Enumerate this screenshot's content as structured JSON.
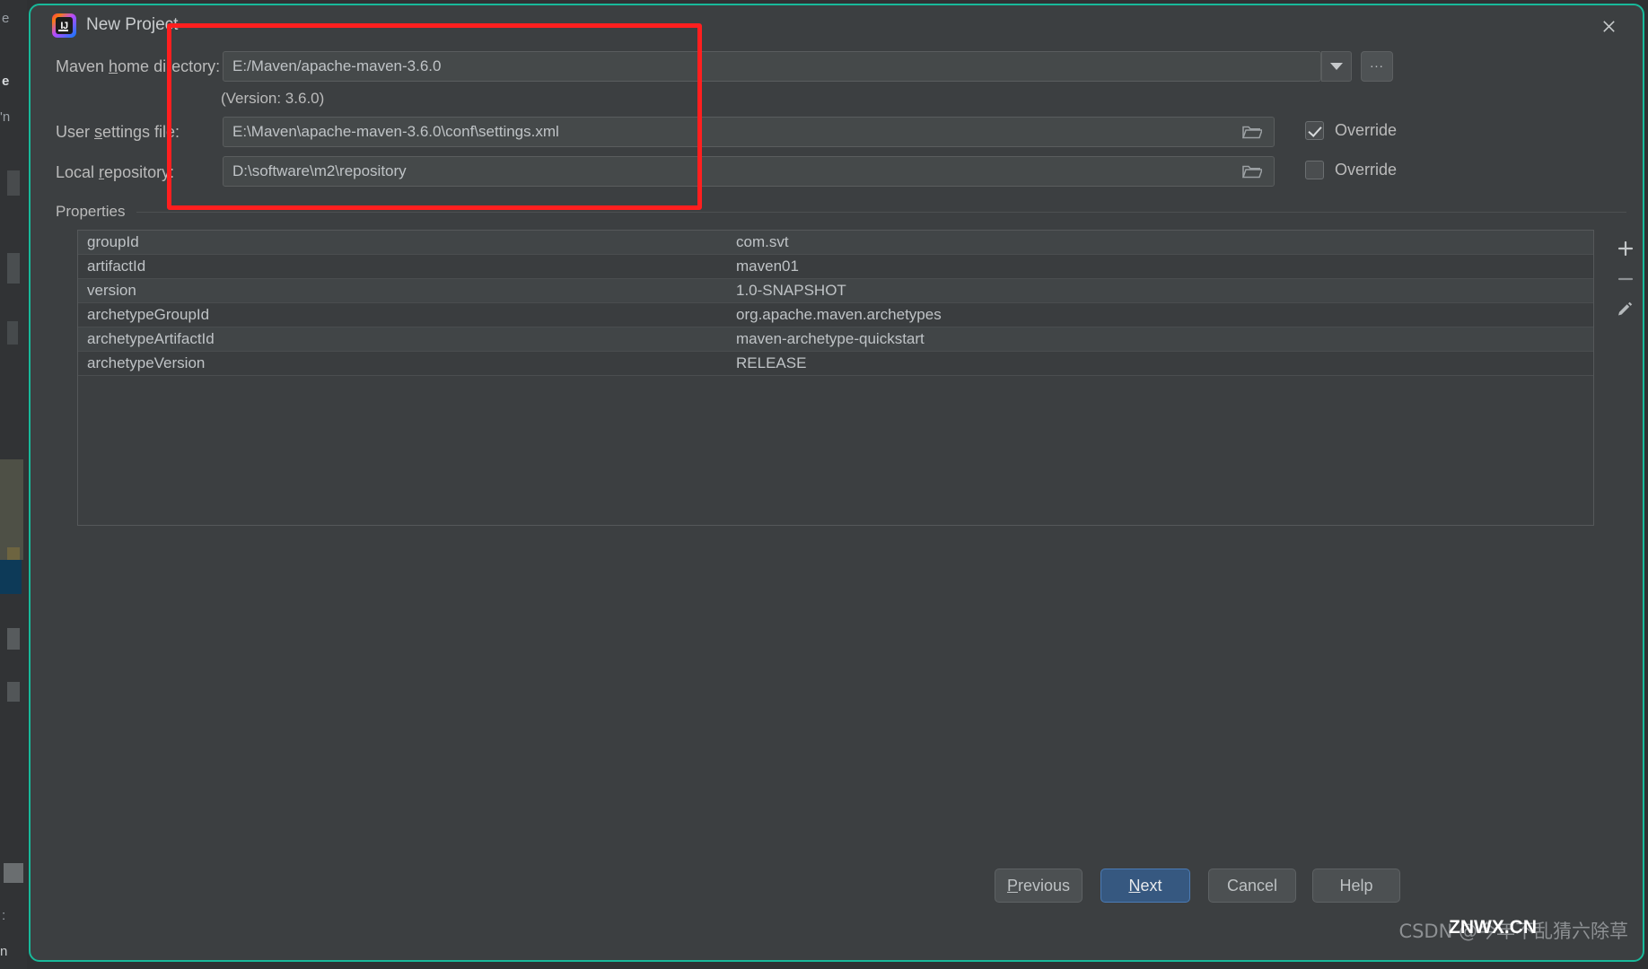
{
  "window": {
    "title": "New Project",
    "logo_icon": "intellij-idea-logo",
    "close_icon": "close-icon"
  },
  "form": {
    "maven_home": {
      "label_pre": "Maven ",
      "label_mn": "h",
      "label_post": "ome directory:",
      "value": "E:/Maven/apache-maven-3.6.0",
      "dropdown_icon": "chevron-down-icon",
      "browse_label": "..."
    },
    "version_note": "(Version: 3.6.0)",
    "user_settings": {
      "label_pre": "User ",
      "label_mn": "s",
      "label_post": "ettings file:",
      "value": "E:\\Maven\\apache-maven-3.6.0\\conf\\settings.xml",
      "folder_icon": "folder-icon",
      "override_label": "Override",
      "override_checked": true
    },
    "local_repository": {
      "label_pre": "Local ",
      "label_mn": "r",
      "label_post": "epository:",
      "value": "D:\\software\\m2\\repository",
      "folder_icon": "folder-icon",
      "override_label": "Override",
      "override_checked": false
    }
  },
  "properties": {
    "caption": "Properties",
    "rows": [
      {
        "key": "groupId",
        "value": "com.svt"
      },
      {
        "key": "artifactId",
        "value": "maven01"
      },
      {
        "key": "version",
        "value": "1.0-SNAPSHOT"
      },
      {
        "key": "archetypeGroupId",
        "value": "org.apache.maven.archetypes"
      },
      {
        "key": "archetypeArtifactId",
        "value": "maven-archetype-quickstart"
      },
      {
        "key": "archetypeVersion",
        "value": "RELEASE"
      }
    ],
    "tools": [
      {
        "name": "add-property-button",
        "icon": "plus-icon"
      },
      {
        "name": "remove-property-button",
        "icon": "minus-icon"
      },
      {
        "name": "edit-property-button",
        "icon": "pencil-icon"
      }
    ]
  },
  "footer": {
    "previous": {
      "pre": "",
      "mn": "P",
      "post": "revious"
    },
    "next": {
      "pre": "",
      "mn": "N",
      "post": "ext"
    },
    "cancel": {
      "pre": "Cancel",
      "mn": "",
      "post": ""
    },
    "help": {
      "pre": "Help",
      "mn": "",
      "post": ""
    }
  },
  "annotation": {
    "shape": "rectangle",
    "color": "#ff1f1f"
  },
  "watermark": {
    "csdn": "CSDN @今年不乱猜六除草",
    "znwx": "ZNWX.CN"
  },
  "theme": {
    "dialog_bg": "#3c3f41",
    "border_accent": "#18b99a",
    "primary_button": "#365880",
    "text": "#bbbbbb"
  }
}
